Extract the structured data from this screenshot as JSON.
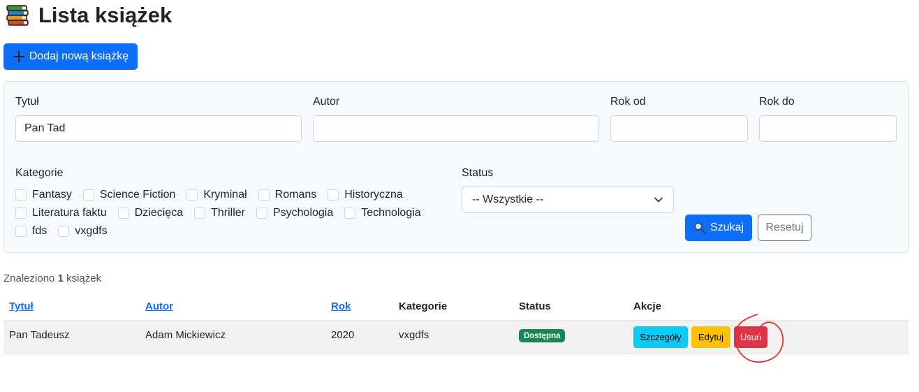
{
  "page": {
    "title": "Lista książek",
    "title_icon": "books-icon",
    "add_button_label": "Dodaj nową książkę"
  },
  "filters": {
    "title_label": "Tytuł",
    "title_value": "Pan Tad",
    "author_label": "Autor",
    "author_value": "",
    "year_from_label": "Rok od",
    "year_from_value": "",
    "year_to_label": "Rok do",
    "year_to_value": "",
    "categories_label": "Kategorie",
    "categories": [
      [
        "Fantasy",
        "Science Fiction",
        "Kryminał",
        "Romans",
        "Historyczna"
      ],
      [
        "Literatura faktu",
        "Dziecięca",
        "Thriller",
        "Psychologia",
        "Technologia"
      ],
      [
        "fds",
        "vxgdfs"
      ]
    ],
    "status_label": "Status",
    "status_selected": "-- Wszystkie --",
    "search_label": "Szukaj",
    "reset_label": "Resetuj"
  },
  "results": {
    "prefix": "Znaleziono",
    "count": "1",
    "suffix": "książek"
  },
  "table": {
    "headers": {
      "title": "Tytuł",
      "author": "Autor",
      "year": "Rok",
      "categories": "Kategorie",
      "status": "Status",
      "actions": "Akcje"
    },
    "rows": [
      {
        "title": "Pan Tadeusz",
        "author": "Adam Mickiewicz",
        "year": "2020",
        "categories": "vxgdfs",
        "status": "Dostępna",
        "details_label": "Szczegóły",
        "edit_label": "Edytuj",
        "delete_label": "Usuń"
      }
    ]
  },
  "colors": {
    "primary": "#0d6efd",
    "success": "#198754",
    "info": "#0dcaf0",
    "warning": "#ffc107",
    "danger": "#dc3545",
    "annotation": "#e0302f"
  }
}
